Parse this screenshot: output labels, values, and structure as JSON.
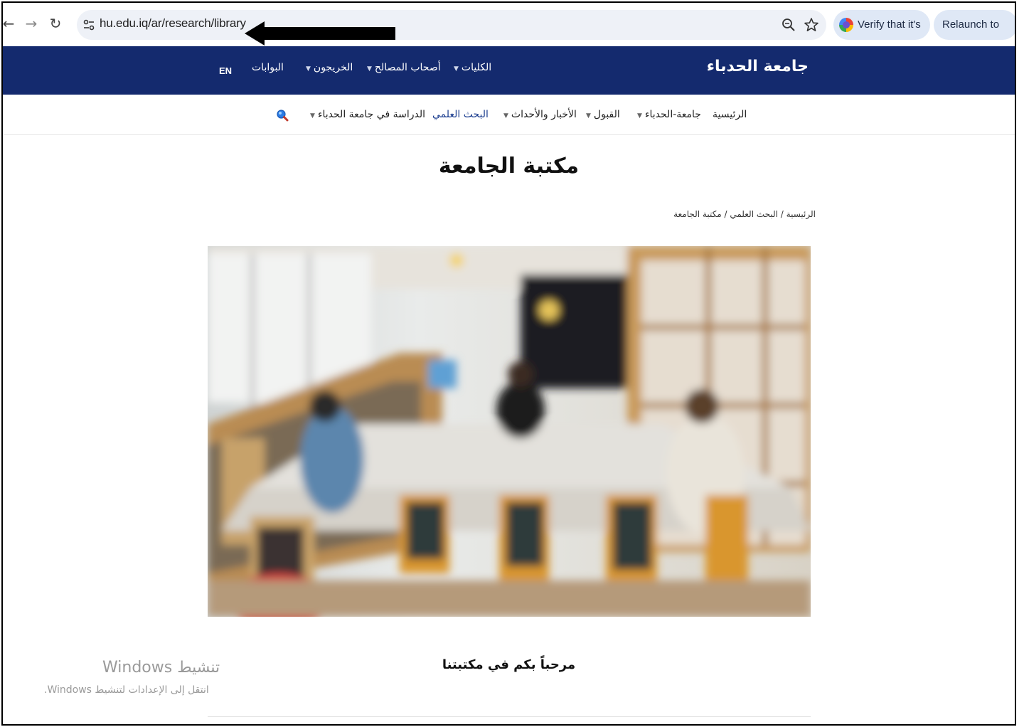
{
  "browser": {
    "url": "hu.edu.iq/ar/research/library",
    "verify_label": "Verify that it's you",
    "relaunch_label": "Relaunch to update"
  },
  "site": {
    "brand": "جامعة الحدباء",
    "lang_toggle": "EN",
    "top_menu": [
      {
        "label": "الكليات",
        "has_dropdown": true
      },
      {
        "label": "أصحاب المصالح",
        "has_dropdown": true
      },
      {
        "label": "الخريجون",
        "has_dropdown": true
      },
      {
        "label": "البوابات",
        "has_dropdown": false
      }
    ],
    "main_nav": [
      {
        "label": "الرئيسية",
        "has_dropdown": false
      },
      {
        "label": "جامعة-الحدباء",
        "has_dropdown": true
      },
      {
        "label": "القبول",
        "has_dropdown": true
      },
      {
        "label": "الأخبار والأحداث",
        "has_dropdown": true
      },
      {
        "label": "البحث العلمي",
        "has_dropdown": false
      },
      {
        "label": "الدراسة في جامعة الحدباء",
        "has_dropdown": true
      }
    ]
  },
  "page": {
    "title": "مكتبة الجامعة",
    "breadcrumb": "الرئيسية / البحث العلمي / مكتبة الجامعة",
    "welcome": "مرحباً بكم في مكتبتنا"
  },
  "os_watermark": {
    "title": "تنشيط Windows",
    "subtitle": "انتقل إلى الإعدادات لتنشيط Windows."
  },
  "colors": {
    "topbar": "#142a6e",
    "active_nav": "#1b3d8f"
  }
}
